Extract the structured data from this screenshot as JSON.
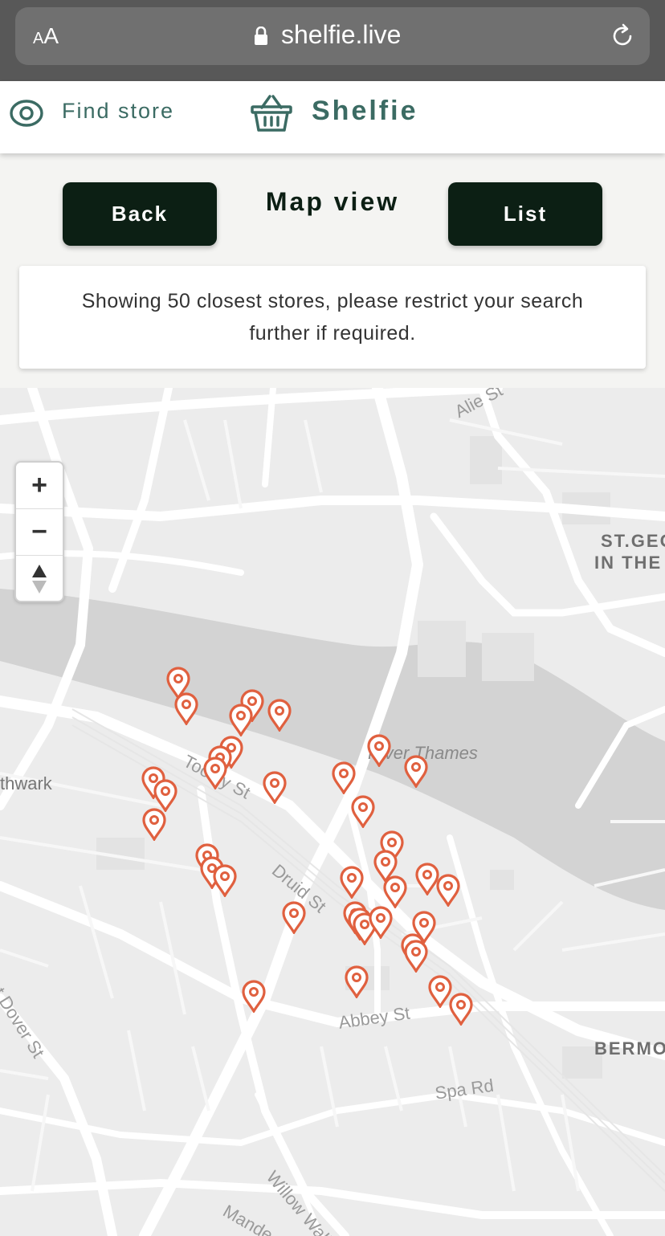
{
  "browser": {
    "text_size_label": "AA",
    "url": "shelfie.live"
  },
  "header": {
    "find_store_label": "Find store",
    "brand_name": "Shelfie"
  },
  "controls": {
    "back_label": "Back",
    "title": "Map view",
    "list_label": "List"
  },
  "notice": {
    "message": "Showing 50 closest stores, please restrict your search further if required."
  },
  "map": {
    "zoom_in_label": "+",
    "zoom_out_label": "−",
    "labels": {
      "alie_st": "Alie St",
      "st_george_1": "ST.GEO",
      "st_george_2": "IN THE",
      "river_thames": "River Thames",
      "southwark": "thwark",
      "tooley_st": "Tooley St",
      "druid_st": "Druid St",
      "abbey_st": "Abbey St",
      "great_dover_st": "at Dover St",
      "bermondsey": "BERMO",
      "spa_rd": "Spa Rd",
      "willow_walk": "Willow Walk",
      "mandela": "Mande"
    },
    "pin_color": "#e0603f"
  }
}
